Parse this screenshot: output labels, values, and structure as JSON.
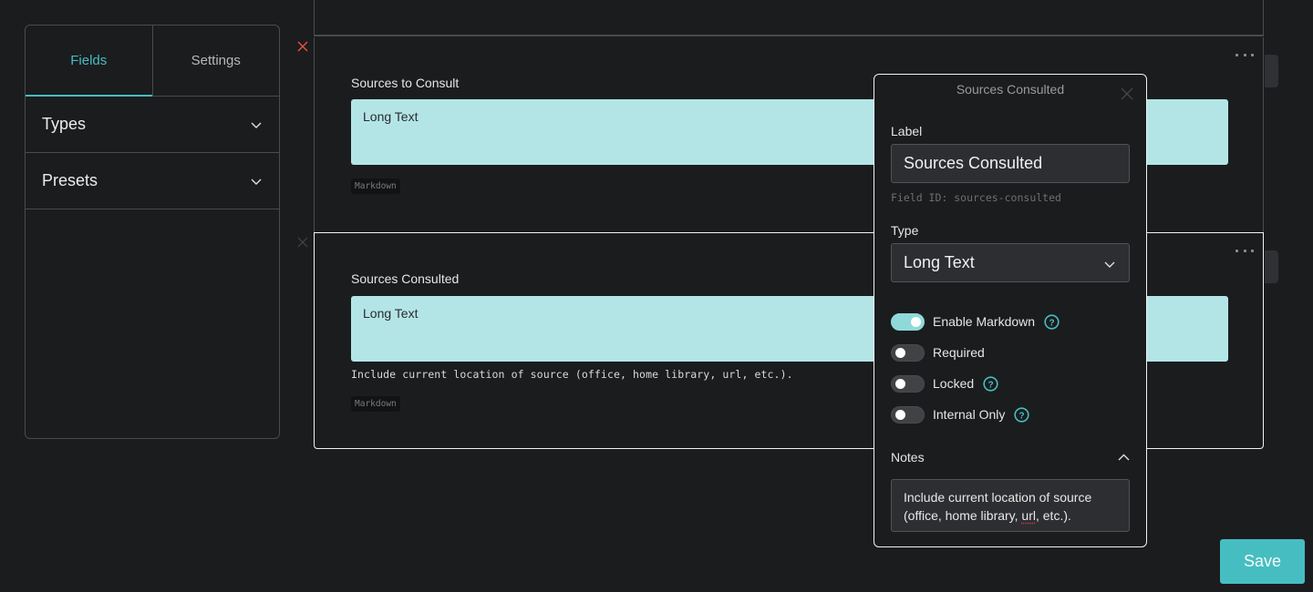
{
  "sidebar": {
    "tabs": [
      {
        "label": "Fields",
        "active": true
      },
      {
        "label": "Settings",
        "active": false
      }
    ],
    "sections": [
      {
        "label": "Types",
        "icon": "chevron-down-icon"
      },
      {
        "label": "Presets",
        "icon": "chevron-down-icon"
      }
    ]
  },
  "fields": [
    {
      "label": "Sources to Consult",
      "preview_text": "Long Text",
      "hint": "",
      "badge": "Markdown",
      "selected": false
    },
    {
      "label": "Sources Consulted",
      "preview_text": "Long Text",
      "hint": "Include current location of source (office, home library, url, etc.).",
      "badge": "Markdown",
      "selected": true
    }
  ],
  "editor": {
    "title": "Sources Consulted",
    "label_caption": "Label",
    "label_value": "Sources Consulted",
    "field_id": "Field ID: sources-consulted",
    "type_caption": "Type",
    "type_value": "Long Text",
    "toggles": [
      {
        "label": "Enable Markdown",
        "on": true,
        "help": true
      },
      {
        "label": "Required",
        "on": false,
        "help": false
      },
      {
        "label": "Locked",
        "on": false,
        "help": true
      },
      {
        "label": "Internal Only",
        "on": false,
        "help": true
      }
    ],
    "notes_caption": "Notes",
    "notes_part1": "Include current location of source (office, home library, ",
    "notes_misspelled": "url",
    "notes_part2": ", etc.)."
  },
  "actions": {
    "save_label": "Save"
  },
  "colors": {
    "accent": "#46bec1",
    "preview_bg": "#b3e5e7",
    "danger": "#e8553e",
    "background": "#1b1c1e"
  }
}
